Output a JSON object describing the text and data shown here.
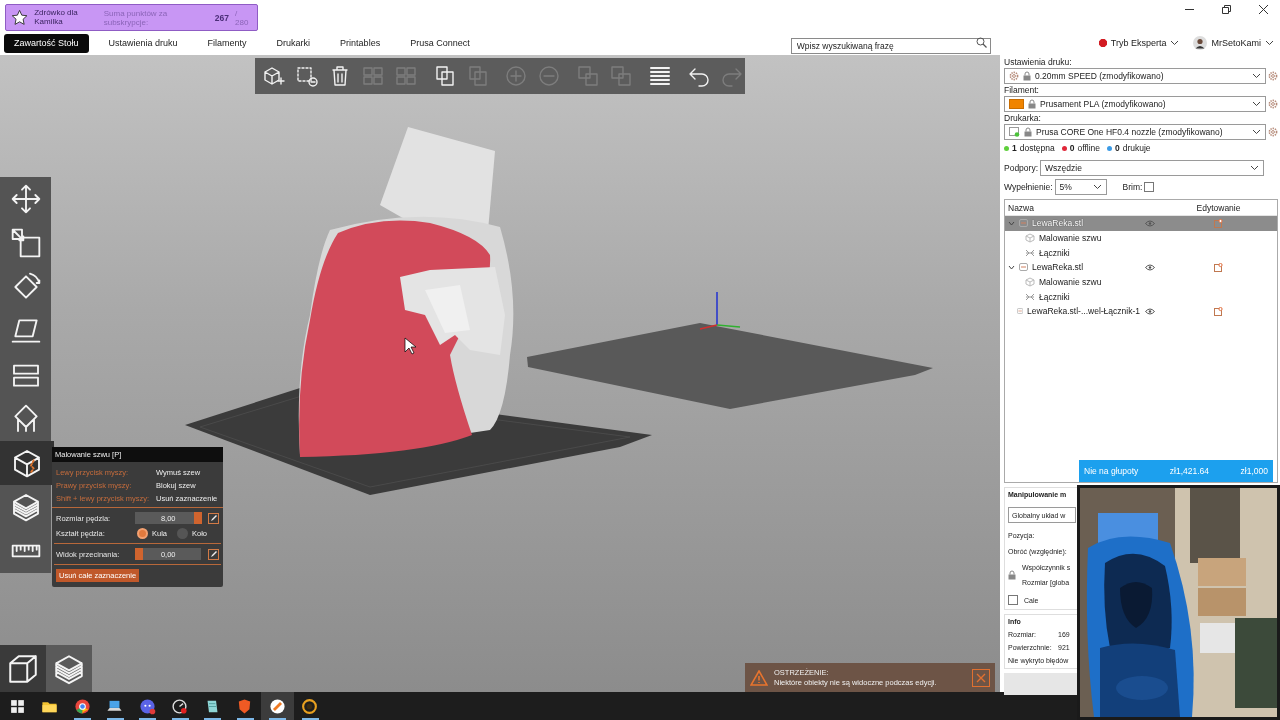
{
  "sub_goal": {
    "title": "Zdrówko dla Kamilka",
    "label": "Suma punktów za subskrypcje:",
    "current": "267",
    "target": "/ 280"
  },
  "tabs": [
    {
      "label": "Zawartość Stołu",
      "selected": true
    },
    {
      "label": "Ustawienia druku",
      "selected": false
    },
    {
      "label": "Filamenty",
      "selected": false
    },
    {
      "label": "Drukarki",
      "selected": false
    },
    {
      "label": "Printables",
      "selected": false
    },
    {
      "label": "Prusa Connect",
      "selected": false
    }
  ],
  "search": {
    "placeholder": "Wpisz wyszukiwaną frazę"
  },
  "mode": {
    "label": "Tryb Eksperta"
  },
  "user": {
    "name": "MrSetoKami"
  },
  "top_toolbar": [
    {
      "kind": "cube-plus",
      "disabled": false
    },
    {
      "kind": "cube-minus",
      "disabled": false
    },
    {
      "kind": "trash",
      "disabled": false
    },
    {
      "kind": "grid",
      "disabled": true
    },
    {
      "kind": "grid",
      "disabled": true
    },
    {
      "kind": "copy",
      "disabled": false
    },
    {
      "kind": "copy",
      "disabled": true
    },
    {
      "kind": "plus-circle",
      "disabled": true
    },
    {
      "kind": "minus-circle",
      "disabled": true
    },
    {
      "kind": "split",
      "disabled": true
    },
    {
      "kind": "split",
      "disabled": true
    },
    {
      "kind": "lines",
      "disabled": false
    },
    {
      "kind": "undo",
      "disabled": false
    },
    {
      "kind": "redo",
      "disabled": true
    }
  ],
  "left_toolbar": [
    {
      "kind": "move",
      "selected": false
    },
    {
      "kind": "scale",
      "selected": false
    },
    {
      "kind": "rotate",
      "selected": false
    },
    {
      "kind": "place",
      "selected": false
    },
    {
      "kind": "cut",
      "selected": false
    },
    {
      "kind": "support",
      "selected": false
    },
    {
      "kind": "seam",
      "selected": true
    },
    {
      "kind": "layers",
      "selected": false
    },
    {
      "kind": "ruler",
      "selected": false
    }
  ],
  "seam_panel": {
    "title": "Malowanie szwu [P]",
    "hints": [
      {
        "key": "Lewy przycisk myszy:",
        "action": "Wymuś szew"
      },
      {
        "key": "Prawy przycisk myszy:",
        "action": "Blokuj szew"
      },
      {
        "key": "Shift + lewy przycisk myszy:",
        "action": "Usuń zaznaczenie"
      }
    ],
    "brush_size": {
      "label": "Rozmiar pędzla:",
      "value": "8,00",
      "level": 1
    },
    "brush_shape": {
      "label": "Kształt pędzla:",
      "options": [
        {
          "label": "Kula",
          "selected": true
        },
        {
          "label": "Koło",
          "selected": false
        }
      ]
    },
    "clipping": {
      "label": "Widok przecinania:",
      "value": "0,00",
      "level": 0
    },
    "clear_button": "Usuń całe zaznaczenie"
  },
  "view_buttons": [
    {
      "kind": "cube",
      "selected": true
    },
    {
      "kind": "layers",
      "selected": false
    }
  ],
  "warning": {
    "title": "OSTRZEŻENIE:",
    "message": "Niektóre obiekty nie są widoczne podczas edycji."
  },
  "print_settings": {
    "label": "Ustawienia druku:",
    "value": "0.20mm SPEED (zmodyfikowano)"
  },
  "filament": {
    "label": "Filament:",
    "value": "Prusament PLA (zmodyfikowano)"
  },
  "printer": {
    "label": "Drukarka:",
    "value": "Prusa CORE One HF0.4 nozzle (zmodyfikowano)"
  },
  "printer_status": [
    {
      "count": "1",
      "label": "dostępna",
      "color": "#5fd03c"
    },
    {
      "count": "0",
      "label": "offline",
      "color": "#e0283a"
    },
    {
      "count": "0",
      "label": "drukuje",
      "color": "#3c9be6"
    }
  ],
  "supports": {
    "label": "Podpory:",
    "value": "Wszędzie"
  },
  "infill": {
    "label": "Wypełnienie:",
    "value": "5%"
  },
  "brim": {
    "label": "Brim:",
    "checked": false
  },
  "object_list": {
    "columns": [
      "Nazwa",
      "Edytowanie"
    ],
    "rows": [
      {
        "name": "LewaReka.stl",
        "selected": true,
        "expanded": true,
        "children": [
          {
            "name": "Malowanie szwu",
            "kind": "seam"
          },
          {
            "name": "Łączniki",
            "kind": "connectors"
          }
        ]
      },
      {
        "name": "LewaReka.stl",
        "selected": false,
        "expanded": true,
        "children": [
          {
            "name": "Malowanie szwu",
            "kind": "seam"
          },
          {
            "name": "Łączniki",
            "kind": "connectors"
          }
        ]
      },
      {
        "name": "LewaReka.stl-...wel-Łącznik-1",
        "selected": false
      }
    ]
  },
  "donation_goal": {
    "label": "Nie na głupoty",
    "current": "zł1,421.64",
    "target": "zł1,000"
  },
  "manipulation": {
    "title": "Manipulowanie m",
    "coordinates": "Globalny układ w",
    "position": "Pozycja:",
    "rotate": "Obróć (względnie):",
    "scale": "Współczynnik s",
    "size": "Rozmiar [globa",
    "inches": {
      "label": "Cale",
      "checked": false
    }
  },
  "info": {
    "title": "Info",
    "rows": [
      {
        "label": "Rozmiar:",
        "value": "169"
      },
      {
        "label": "Powierzchnie:",
        "value": "921"
      }
    ],
    "message": "Nie wykryto błędów"
  },
  "taskbar": [
    {
      "kind": "start",
      "running": false,
      "selected": false
    },
    {
      "kind": "folder",
      "running": false,
      "selected": false
    },
    {
      "kind": "browser",
      "running": true,
      "selected": false
    },
    {
      "kind": "laptop",
      "running": true,
      "selected": false
    },
    {
      "kind": "chat",
      "running": true,
      "selected": false
    },
    {
      "kind": "gauge",
      "running": true,
      "selected": false
    },
    {
      "kind": "notebook",
      "running": true,
      "selected": false
    },
    {
      "kind": "shield",
      "running": true,
      "selected": false
    },
    {
      "kind": "slicer",
      "running": true,
      "selected": true
    },
    {
      "kind": "ring",
      "running": true,
      "selected": false
    }
  ]
}
